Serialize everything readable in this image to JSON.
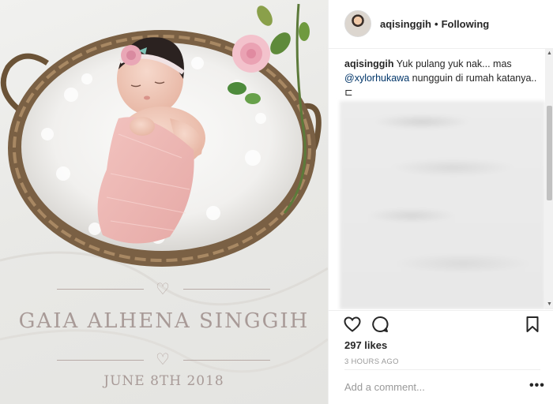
{
  "post": {
    "photo": {
      "name_text": "GAIA ALHENA SINGGIH",
      "date_text": "JUNE 8TH 2018"
    },
    "header": {
      "username": "aqisinggih",
      "separator": "•",
      "follow_status": "Following"
    },
    "caption": {
      "username": "aqisinggih",
      "text_before": " Yuk pulang yuk nak... mas ",
      "mention": "@xylorhukawa",
      "text_after": " nungguin di rumah katanya.. ",
      "emoji": "⊏"
    },
    "actions": {
      "like_icon": "heart-outline-icon",
      "comment_icon": "speech-bubble-icon",
      "save_icon": "bookmark-icon"
    },
    "likes": "297 likes",
    "timestamp": "3 HOURS AGO",
    "add_comment_placeholder": "Add a comment...",
    "more_label": "•••"
  },
  "colors": {
    "link": "#003569",
    "text": "#262626",
    "muted": "#999999",
    "photo_text": "#a89a97"
  }
}
